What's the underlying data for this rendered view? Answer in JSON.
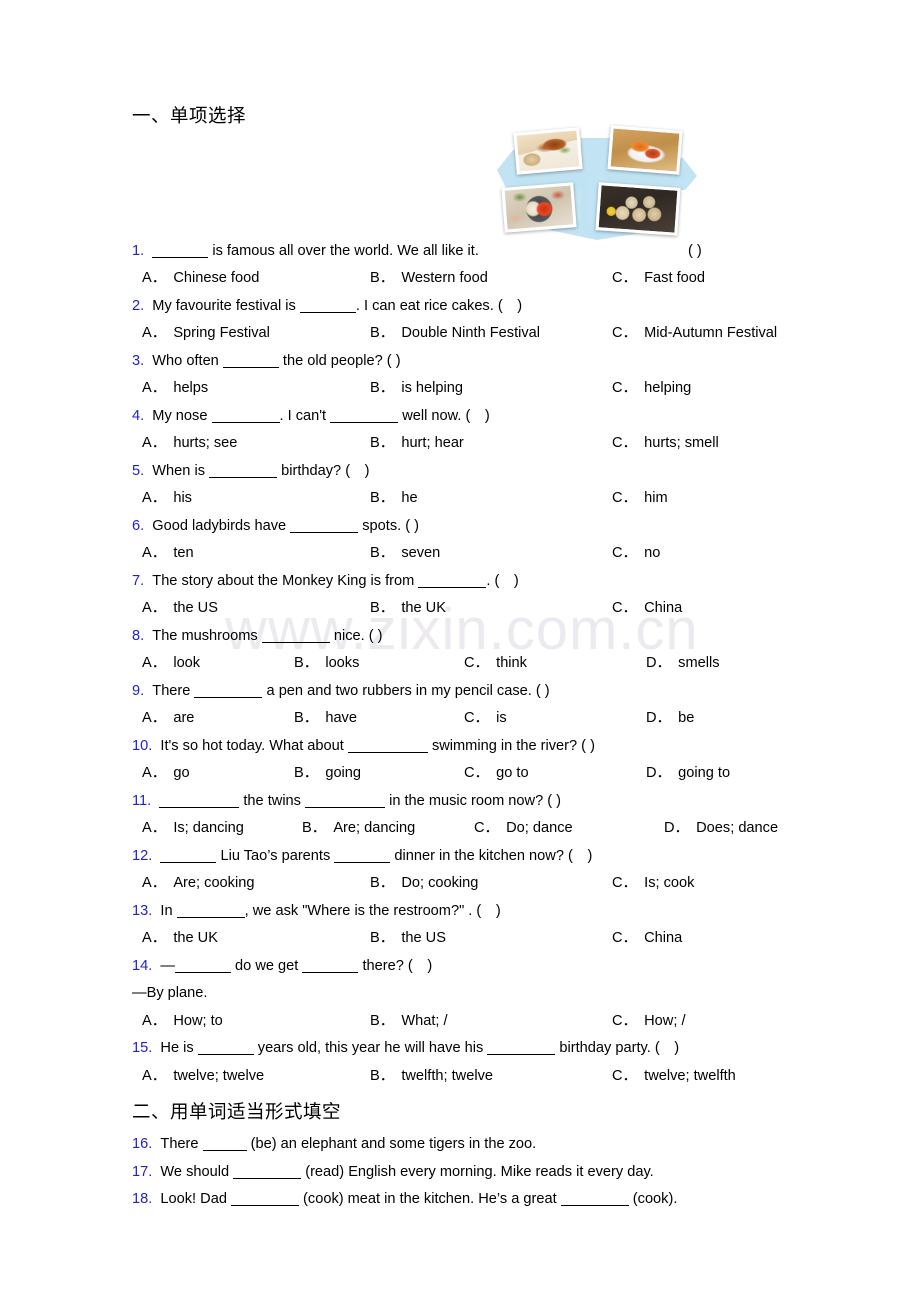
{
  "document": {
    "watermark": "www.zixin.com.cn"
  },
  "sections": [
    {
      "heading": "一、单项选择"
    },
    {
      "heading": "二、用单词适当形式填空"
    }
  ],
  "collage": {
    "name": "chinese-food-collage",
    "background_color": "#bfe2f2",
    "photos": [
      {
        "alt": "peking-duck"
      },
      {
        "alt": "chili-dish"
      },
      {
        "alt": "hot-pot"
      },
      {
        "alt": "dim-sum"
      }
    ]
  },
  "questions": [
    {
      "num": "1.",
      "text_before": "",
      "blank": "b-md",
      "text_after": " is famous all over the world. We all like it.",
      "paren": "( )",
      "paren_far": true,
      "options": [
        {
          "tag": "A．",
          "label": "Chinese food"
        },
        {
          "tag": "B．",
          "label": "Western food"
        },
        {
          "tag": "C．",
          "label": "Fast food"
        }
      ],
      "cols": "c3"
    },
    {
      "num": "2.",
      "text_before": "My favourite festival is ",
      "blank": "b-md",
      "text_after": ". I can eat rice cakes. (　)",
      "options": [
        {
          "tag": "A．",
          "label": "Spring Festival"
        },
        {
          "tag": "B．",
          "label": "Double Ninth Festival"
        },
        {
          "tag": "C．",
          "label": "Mid-Autumn Festival"
        }
      ],
      "cols": "c3"
    },
    {
      "num": "3.",
      "text_before": "Who often ",
      "blank": "b-md",
      "text_after": " the old people? ( )",
      "options": [
        {
          "tag": "A．",
          "label": "helps"
        },
        {
          "tag": "B．",
          "label": "is helping"
        },
        {
          "tag": "C．",
          "label": "helping"
        }
      ],
      "cols": "c3"
    },
    {
      "num": "4.",
      "text_before": "My nose ",
      "blank": "b-lg",
      "text_after": ". I can't ",
      "blank2": "b-lg",
      "text_after2": " well now. (　)",
      "options": [
        {
          "tag": "A．",
          "label": "hurts; see"
        },
        {
          "tag": "B．",
          "label": "hurt; hear"
        },
        {
          "tag": "C．",
          "label": "hurts; smell"
        }
      ],
      "cols": "c3"
    },
    {
      "num": "5.",
      "text_before": "When is ",
      "blank": "b-lg",
      "text_after": " birthday? (　)",
      "options": [
        {
          "tag": "A．",
          "label": "his"
        },
        {
          "tag": "B．",
          "label": "he"
        },
        {
          "tag": "C．",
          "label": "him"
        }
      ],
      "cols": "c3"
    },
    {
      "num": "6.",
      "text_before": "Good ladybirds have ",
      "blank": "b-lg",
      "text_after": " spots. ( )",
      "options": [
        {
          "tag": "A．",
          "label": "ten"
        },
        {
          "tag": "B．",
          "label": "seven"
        },
        {
          "tag": "C．",
          "label": "no"
        }
      ],
      "cols": "c3"
    },
    {
      "num": "7.",
      "text_before": "The story about the Monkey King is from ",
      "blank": "b-lg",
      "text_after": ". (　)",
      "options": [
        {
          "tag": "A．",
          "label": "the US"
        },
        {
          "tag": "B．",
          "label": "the UK"
        },
        {
          "tag": "C．",
          "label": "China"
        }
      ],
      "cols": "c3"
    },
    {
      "num": "8.",
      "text_before": "The mushrooms ",
      "blank": "b-lg",
      "text_after": " nice. ( )",
      "options": [
        {
          "tag": "A．",
          "label": "look"
        },
        {
          "tag": "B．",
          "label": "looks"
        },
        {
          "tag": "C．",
          "label": "think"
        },
        {
          "tag": "D．",
          "label": "smells"
        }
      ],
      "cols": "c4"
    },
    {
      "num": "9.",
      "text_before": "There ",
      "blank": "b-lg",
      "text_after": " a pen and two rubbers in my pencil case. ( )",
      "options": [
        {
          "tag": "A．",
          "label": "are"
        },
        {
          "tag": "B．",
          "label": "have"
        },
        {
          "tag": "C．",
          "label": "is"
        },
        {
          "tag": "D．",
          "label": "be"
        }
      ],
      "cols": "c4"
    },
    {
      "num": "10.",
      "text_before": "It's so hot today. What about ",
      "blank": "b-xl",
      "text_after": " swimming in the river? ( )",
      "options": [
        {
          "tag": "A．",
          "label": "go"
        },
        {
          "tag": "B．",
          "label": "going"
        },
        {
          "tag": "C．",
          "label": "go to"
        },
        {
          "tag": "D．",
          "label": "going to"
        }
      ],
      "cols": "c4"
    },
    {
      "num": "11.",
      "text_before": "",
      "blank": "b-xl",
      "text_after": " the twins ",
      "blank2": "b-xl",
      "text_after2": " in the music room now? ( )",
      "options": [
        {
          "tag": "A．",
          "label": "Is; dancing"
        },
        {
          "tag": "B．",
          "label": "Are; dancing"
        },
        {
          "tag": "C．",
          "label": "Do; dance"
        },
        {
          "tag": "D．",
          "label": "Does; dance"
        }
      ],
      "cols": "c4b"
    },
    {
      "num": "12.",
      "text_before": "",
      "blank": "b-md",
      "text_after": " Liu Tao’s parents ",
      "blank2": "b-md",
      "text_after2": " dinner in the kitchen now? (　)",
      "options": [
        {
          "tag": "A．",
          "label": "Are; cooking"
        },
        {
          "tag": "B．",
          "label": "Do; cooking"
        },
        {
          "tag": "C．",
          "label": "Is; cook"
        }
      ],
      "cols": "c3"
    },
    {
      "num": "13.",
      "text_before": "In ",
      "blank": "b-lg",
      "text_after": ", we ask \"Where is the restroom?\" . (　)",
      "options": [
        {
          "tag": "A．",
          "label": "the UK"
        },
        {
          "tag": "B．",
          "label": "the US"
        },
        {
          "tag": "C．",
          "label": "China"
        }
      ],
      "cols": "c3"
    },
    {
      "num": "14.",
      "text_before": "—",
      "blank": "b-md",
      "text_after": " do we get ",
      "blank2": "b-md",
      "text_after2": " there? (　)",
      "answer_line": "—By plane.",
      "options": [
        {
          "tag": "A．",
          "label": "How; to"
        },
        {
          "tag": "B．",
          "label": "What; /"
        },
        {
          "tag": "C．",
          "label": "How; /"
        }
      ],
      "cols": "c3"
    },
    {
      "num": "15.",
      "text_before": "He is ",
      "blank": "b-md",
      "text_after": " years old, this year he will have his ",
      "blank2": "b-lg",
      "text_after2": " birthday party. (　)",
      "options": [
        {
          "tag": "A．",
          "label": "twelve; twelve"
        },
        {
          "tag": "B．",
          "label": "twelfth; twelve"
        },
        {
          "tag": "C．",
          "label": "twelve; twelfth"
        }
      ],
      "cols": "c3"
    }
  ],
  "fill_questions": [
    {
      "num": "16.",
      "text_before": "There ",
      "blank": "b-sm",
      "text_after": " (be) an elephant and some tigers in the zoo."
    },
    {
      "num": "17.",
      "text_before": "We should ",
      "blank": "b-lg",
      "text_after": " (read) English every morning. Mike reads it every day."
    },
    {
      "num": "18.",
      "text_before": "Look! Dad ",
      "blank": "b-lg",
      "text_after": " (cook) meat in the kitchen. He’s a great ",
      "blank2": "b-lg",
      "text_after2": " (cook)."
    }
  ]
}
